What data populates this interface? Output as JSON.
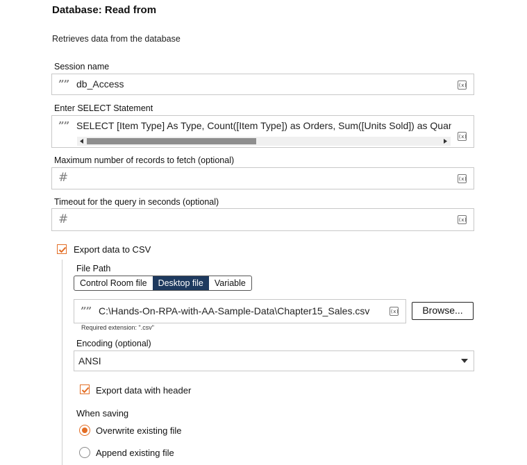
{
  "header": {
    "title": "Database: Read from",
    "description": "Retrieves data from the database"
  },
  "session": {
    "label": "Session name",
    "value": "db_Access"
  },
  "select": {
    "label": "Enter SELECT Statement",
    "value": "SELECT [Item Type] As Type, Count([Item Type]) as Orders, Sum([Units Sold]) as Quan"
  },
  "max_records": {
    "label": "Maximum number of records to fetch (optional)",
    "value": ""
  },
  "timeout": {
    "label": "Timeout for the query in seconds (optional)",
    "value": ""
  },
  "export_csv": {
    "label": "Export data to CSV",
    "checked": true
  },
  "file_path": {
    "label": "File Path",
    "tabs": [
      "Control Room file",
      "Desktop file",
      "Variable"
    ],
    "active_tab": "Desktop file",
    "value": "C:\\Hands-On-RPA-with-AA-Sample-Data\\Chapter15_Sales.csv",
    "hint": "Required extension: \".csv\"",
    "browse_label": "Browse..."
  },
  "encoding": {
    "label": "Encoding (optional)",
    "value": "ANSI"
  },
  "export_header": {
    "label": "Export data with header",
    "checked": true
  },
  "when_saving": {
    "label": "When saving",
    "options": [
      "Overwrite existing file",
      "Append existing file"
    ],
    "selected": "Overwrite existing file"
  },
  "icons": {
    "variable": "(x)",
    "quote": "””",
    "hash": "#"
  },
  "colors": {
    "accent": "#e36d24",
    "active_tab": "#1e3a5f"
  }
}
